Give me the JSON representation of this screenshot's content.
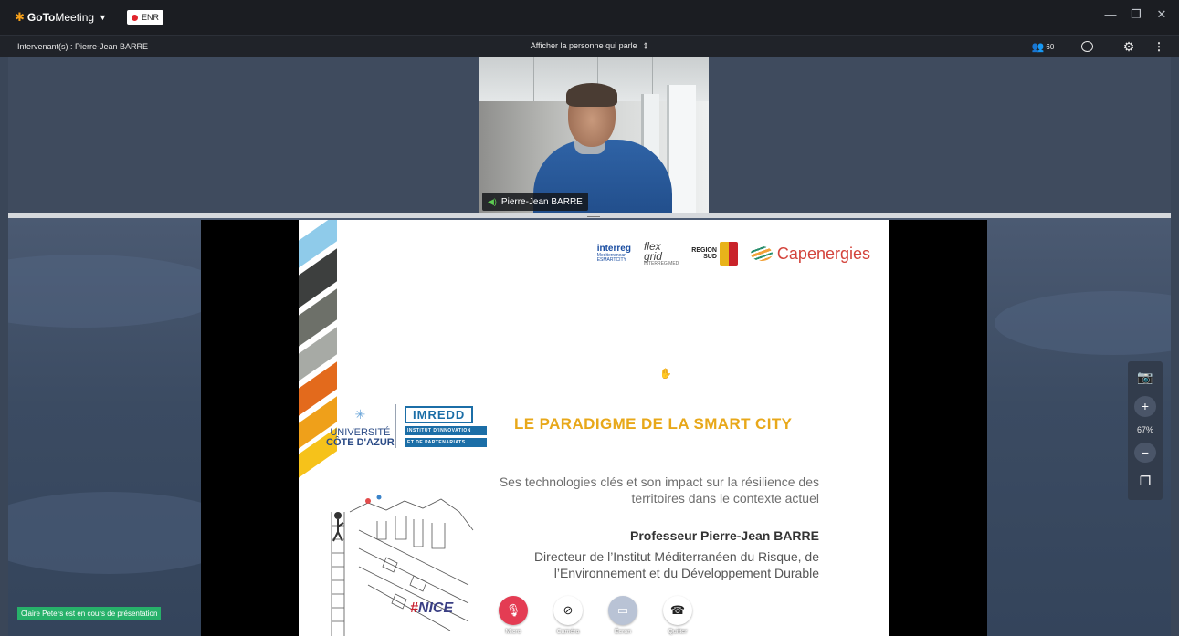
{
  "app": {
    "brand_goto": "GoTo",
    "brand_meeting": "Meeting",
    "recording_label": "ENR"
  },
  "window_controls": {
    "minimize": "—",
    "restore": "❐",
    "close": "✕"
  },
  "toolbar": {
    "speakers": "Intervenant(s) : Pierre-Jean BARRE",
    "view_mode": "Afficher la personne qui parle",
    "attendee_count": "60"
  },
  "camera": {
    "participant_name": "Pierre-Jean BARRE"
  },
  "slide": {
    "logos": {
      "interreg": "interreg",
      "interreg_sub": "Mediterranean",
      "esmartcity": "ESMARTCITY",
      "flex": "flex",
      "grid": "grid",
      "flexgrid_sub": "INTERREG MED",
      "region_line1": "REGION",
      "region_line2": "SUD",
      "capenergies": "Capenergies"
    },
    "uca_line1": "UNIVERSITÉ",
    "uca_line2": "CÔTE D'AZUR",
    "imredd": "IMREDD",
    "imredd_band1": "INSTITUT D'INNOVATION",
    "imredd_band2": "ET DE PARTENARIATS",
    "title": "LE PARADIGME DE LA SMART CITY",
    "subtitle_line1": "Ses technologies clés et son impact sur la résilience des",
    "subtitle_line2": "territoires dans le contexte actuel",
    "presenter": "Professeur Pierre-Jean BARRE",
    "director_line1": "Directeur de l’Institut Méditerranéen du Risque, de",
    "director_line2": "l’Environnement et du Développement Durable",
    "hashtag_hash": "#",
    "hashtag_word": "NICE"
  },
  "controls": {
    "mic": "Micro",
    "camera": "Caméra",
    "screen": "Écran",
    "leave": "Quitter"
  },
  "zoom": {
    "level": "67%"
  },
  "presenting_status": "Claire Peters est en cours de présentation",
  "colors": {
    "title_accent": "#e8a81a",
    "imredd_blue": "#1b6ea7",
    "mic_muted": "#e43c53",
    "presenting_green": "#27b16a"
  }
}
